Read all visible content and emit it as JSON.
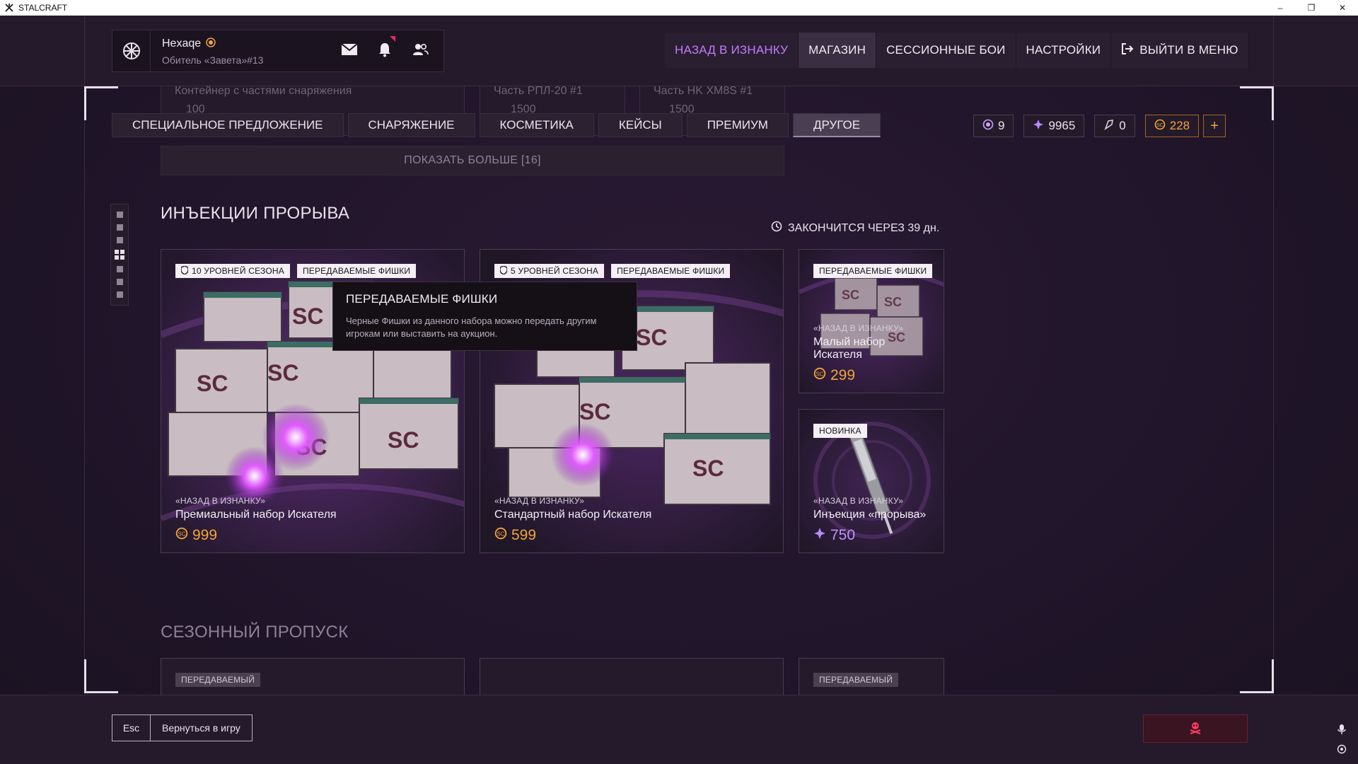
{
  "os": {
    "title": "STALCRAFT",
    "minimize": "–",
    "maximize": "❐",
    "close": "✕"
  },
  "profile": {
    "nickname": "Hexaqe",
    "clan": "Обитель «Завета»#13"
  },
  "nav": {
    "items": [
      {
        "label": "НАЗАД В ИЗНАНКУ"
      },
      {
        "label": "МАГАЗИН"
      },
      {
        "label": "СЕССИОННЫЕ БОИ"
      },
      {
        "label": "НАСТРОЙКИ"
      },
      {
        "label": "ВЫЙТИ В МЕНЮ"
      }
    ]
  },
  "ghost": {
    "card1_title": "Контейнер с частями снаряжения",
    "card1_price": "100",
    "card2_title": "Часть РПЛ-20 #1",
    "card2_price": "1500",
    "card3_title": "Часть HK XM8S #1",
    "card3_price": "1500"
  },
  "categories": {
    "items": [
      {
        "label": "СПЕЦИАЛЬНОЕ ПРЕДЛОЖЕНИЕ"
      },
      {
        "label": "СНАРЯЖЕНИЕ"
      },
      {
        "label": "КОСМЕТИКА"
      },
      {
        "label": "КЕЙСЫ"
      },
      {
        "label": "ПРЕМИУМ"
      },
      {
        "label": "ДРУГОЕ"
      }
    ],
    "active": "ДРУГОЕ"
  },
  "currencies": {
    "tokens": "9",
    "crystals": "9965",
    "parts": "0",
    "coins": "228",
    "add": "+"
  },
  "show_more": "ПОКАЗАТЬ БОЛЬШЕ [16]",
  "section1": {
    "title": "ИНЪЕКЦИИ ПРОРЫВА",
    "timer": "ЗАКОНЧИТСЯ ЧЕРЕЗ 39 дн."
  },
  "cards": [
    {
      "tag1": "10 УРОВНЕЙ СЕЗОНА",
      "tag2": "ПЕРЕДАВАЕМЫЕ ФИШКИ",
      "subtitle": "«НАЗАД В ИЗНАНКУ»",
      "title": "Премиальный набор Искателя",
      "price": "999"
    },
    {
      "tag1": "5 УРОВНЕЙ СЕЗОНА",
      "tag2": "ПЕРЕДАВАЕМЫЕ ФИШКИ",
      "subtitle": "«НАЗАД В ИЗНАНКУ»",
      "title": "Стандартный набор Искателя",
      "price": "599"
    },
    {
      "tag1": "ПЕРЕДАВАЕМЫЕ ФИШКИ",
      "subtitle": "«НАЗАД В ИЗНАНКУ»",
      "title": "Малый набор Искателя",
      "price": "299"
    },
    {
      "tag1": "НОВИНКА",
      "subtitle": "«НАЗАД В ИЗНАНКУ»",
      "title": "Инъекция «прорыва»",
      "price": "750"
    }
  ],
  "tooltip": {
    "title": "ПЕРЕДАВАЕМЫЕ ФИШКИ",
    "text": "Черные Фишки из данного набора можно передать другим игрокам или выставить на аукцион."
  },
  "section2": {
    "title": "СЕЗОННЫЙ ПРОПУСК",
    "tag_left": "ПЕРЕДАВАЕМЫЙ",
    "tag_right": "ПЕРЕДАВАЕМЫЙ"
  },
  "bottom": {
    "esc_key": "Esc",
    "esc_action": "Вернуться в игру"
  },
  "colors": {
    "accent_purple": "#c37bff",
    "gold": "#f0a53a",
    "danger": "#e0305a"
  }
}
